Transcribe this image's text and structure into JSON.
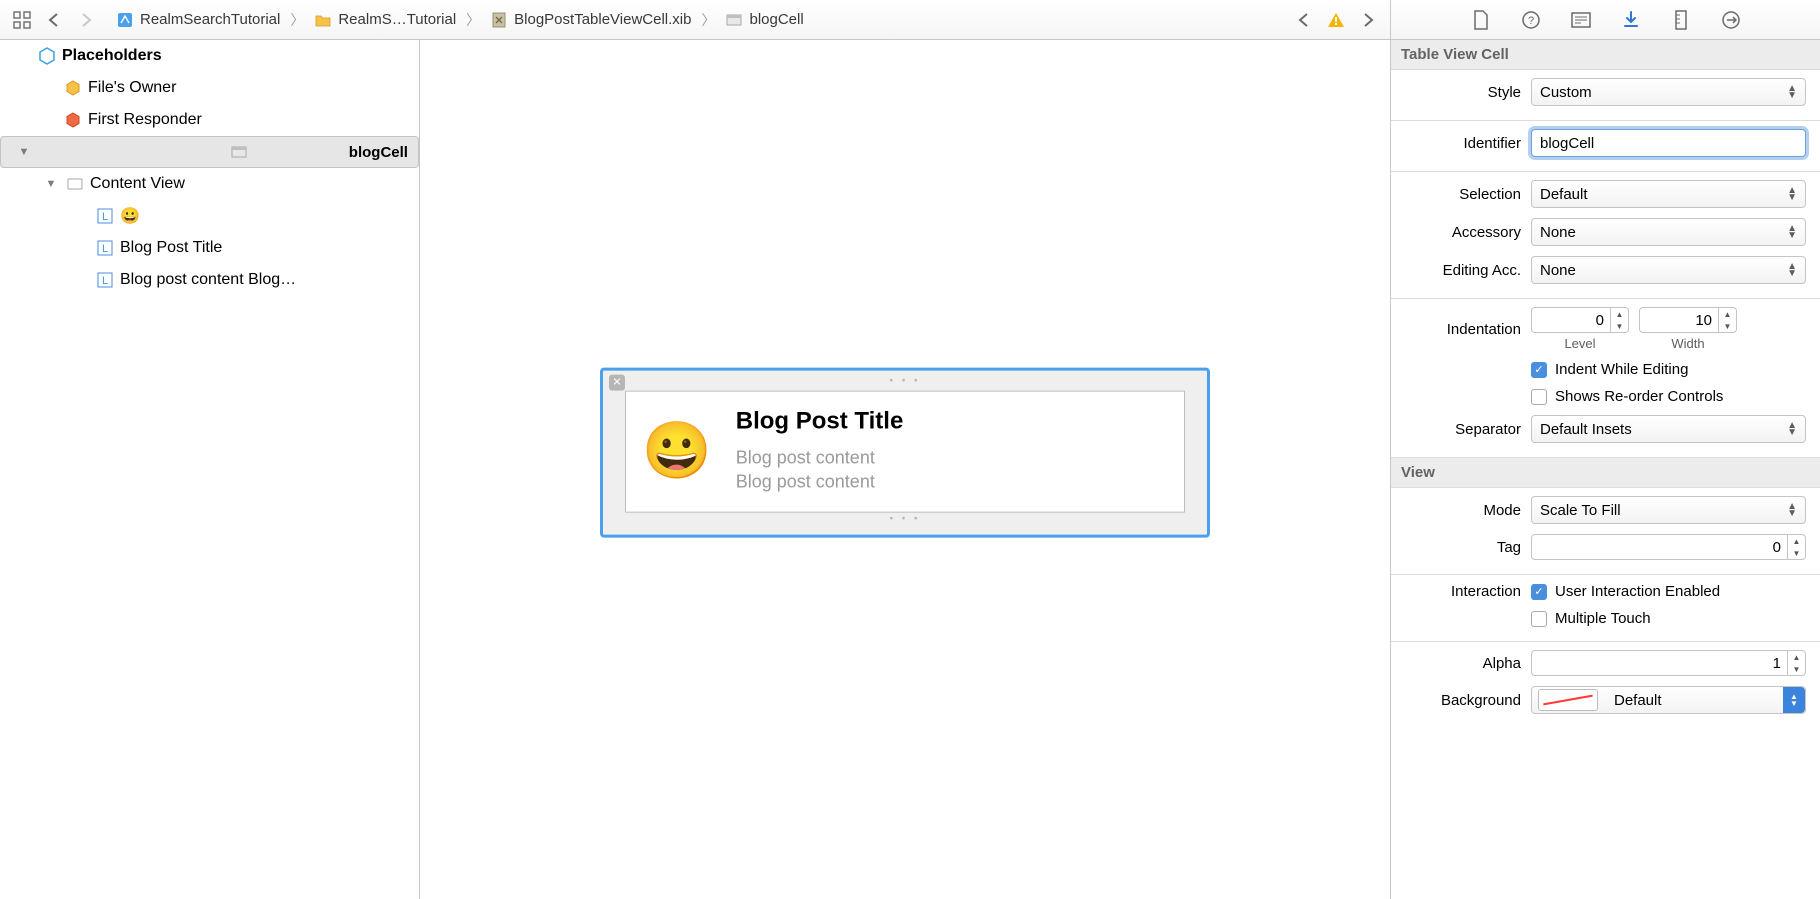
{
  "breadcrumb": {
    "item1": "RealmSearchTutorial",
    "item2": "RealmS…Tutorial",
    "item3": "BlogPostTableViewCell.xib",
    "item4": "blogCell"
  },
  "outline": {
    "placeholders_header": "Placeholders",
    "files_owner": "File's Owner",
    "first_responder": "First Responder",
    "blogcell": "blogCell",
    "content_view": "Content View",
    "label_emoji": "😀",
    "label_title": "Blog Post Title",
    "label_content": "Blog post content Blog…"
  },
  "canvas": {
    "title": "Blog Post Title",
    "content_line1": "Blog post content",
    "content_line2": "Blog post content",
    "emoji": "😀"
  },
  "inspector": {
    "tablecell": {
      "header": "Table View Cell",
      "style_label": "Style",
      "style_value": "Custom",
      "identifier_label": "Identifier",
      "identifier_value": "blogCell",
      "selection_label": "Selection",
      "selection_value": "Default",
      "accessory_label": "Accessory",
      "accessory_value": "None",
      "editing_acc_label": "Editing Acc.",
      "editing_acc_value": "None",
      "indentation_label": "Indentation",
      "indent_level_value": "0",
      "indent_level_caption": "Level",
      "indent_width_value": "10",
      "indent_width_caption": "Width",
      "indent_while_editing": "Indent While Editing",
      "shows_reorder": "Shows Re-order Controls",
      "separator_label": "Separator",
      "separator_value": "Default Insets"
    },
    "view": {
      "header": "View",
      "mode_label": "Mode",
      "mode_value": "Scale To Fill",
      "tag_label": "Tag",
      "tag_value": "0",
      "interaction_label": "Interaction",
      "user_interaction": "User Interaction Enabled",
      "multiple_touch": "Multiple Touch",
      "alpha_label": "Alpha",
      "alpha_value": "1",
      "background_label": "Background",
      "background_value": "Default"
    }
  }
}
